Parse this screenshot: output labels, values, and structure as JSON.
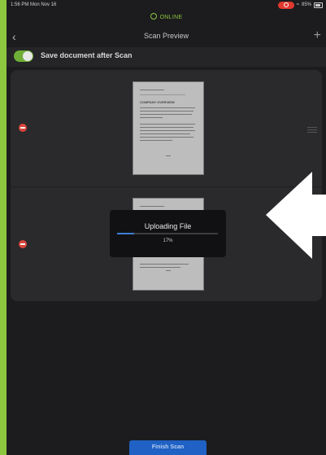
{
  "status_bar": {
    "time": "1:56 PM  Mon Nov 16",
    "battery": "85%"
  },
  "connection": {
    "status": "ONLINE",
    "color": "#8dc63f"
  },
  "navbar": {
    "title": "Scan Preview",
    "back_icon": "chevron-left-icon",
    "add_icon": "plus-icon"
  },
  "settings": {
    "save_label": "Save document after Scan",
    "save_enabled": true
  },
  "pages": [
    {
      "page_heading": "COMPANY OVERVIEW"
    },
    {}
  ],
  "upload": {
    "title": "Uploading File",
    "percent_text": "17%",
    "progress": 0.17
  },
  "footer": {
    "finish_label": "Finish Scan"
  },
  "colors": {
    "accent": "#8dc63f",
    "primary_button": "#1f61c4",
    "delete": "#d9453b",
    "progress": "#3d7fd6"
  }
}
